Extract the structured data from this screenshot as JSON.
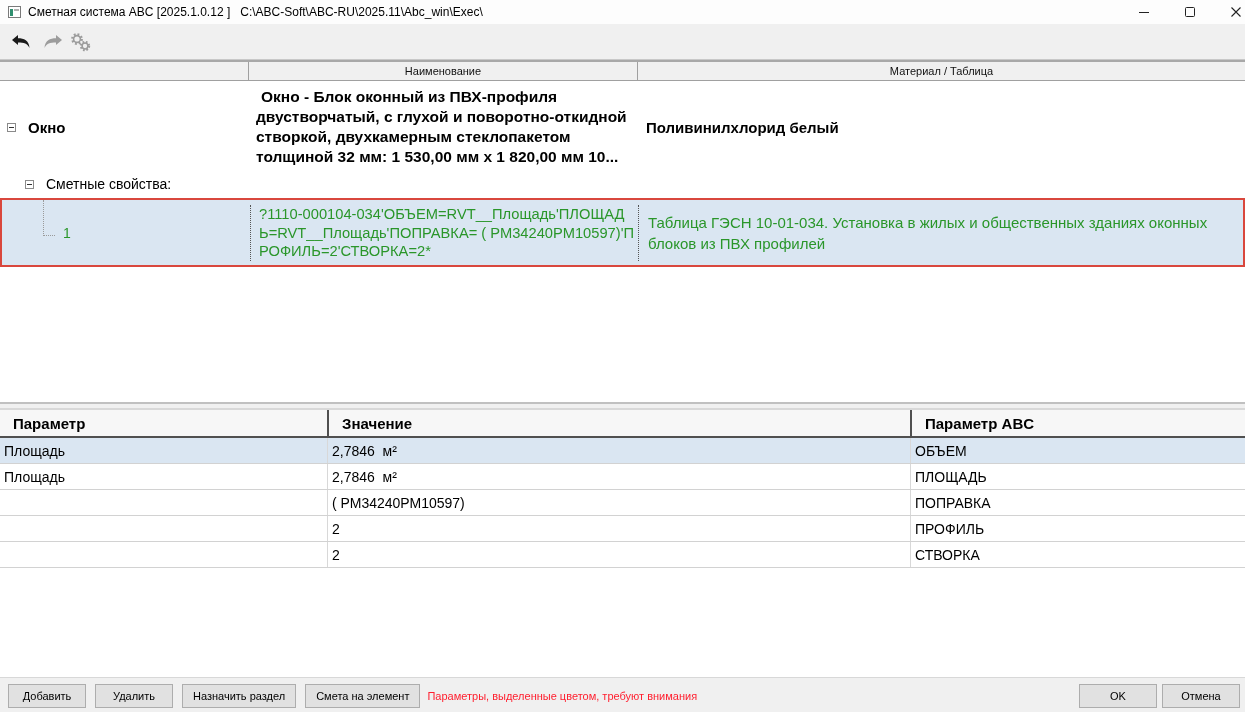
{
  "window": {
    "title": "Сметная система ABC [2025.1.0.12 ]   C:\\ABC-Soft\\ABC-RU\\2025.11\\Abc_win\\Exec\\"
  },
  "toolbar": [
    {
      "kind": "undo",
      "disabled": false
    },
    {
      "kind": "redo",
      "disabled": true
    },
    {
      "kind": "settings",
      "disabled": true
    }
  ],
  "tree": {
    "columns": [
      "Наименование",
      "Материал / Таблица"
    ],
    "rows": [
      {
        "kind": "element",
        "name": "Окно",
        "expanded": true,
        "selected": false,
        "description": "Окно - Блок оконный из ПВХ-профиля двустворчатый, с глухой и поворотно-откидной створкой, двухкамерным стеклопакетом толщиной 32 мм: 1 530,00 мм x 1 820,00 мм 10...",
        "material": "Поливинилхлорид белый",
        "children": [
          {
            "kind": "group",
            "name": "Сметные свойства:",
            "expanded": true,
            "selected": false,
            "children": [
              {
                "kind": "estimate",
                "name": "1",
                "selected": true,
                "description": "?1110-000104-034'ОБЪЕМ=RVT__Площадь'ПЛОЩАДЬ=RVT__Площадь'ПОПРАВКА= ( РМ34240РМ10597)'ПРОФИЛЬ=2'СТВОРКА=2*",
                "material": "Таблица ГЭСН 10-01-034. Установка в жилых и общественных зданиях оконных блоков из ПВХ профилей"
              }
            ]
          }
        ]
      }
    ]
  },
  "parameters": {
    "columns": [
      "Параметр",
      "Значение",
      "Параметр ABC"
    ],
    "rows": [
      {
        "parameter": "Площадь",
        "value": "2,7846  м²",
        "abc_parameter": "ОБЪЕМ",
        "selected": true
      },
      {
        "parameter": "Площадь",
        "value": "2,7846  м²",
        "abc_parameter": "ПЛОЩАДЬ",
        "selected": false
      },
      {
        "value": "( РМ34240РМ10597)",
        "abc_parameter": "ПОПРАВКА",
        "selected": false
      },
      {
        "value": "2",
        "abc_parameter": "ПРОФИЛЬ",
        "selected": false
      },
      {
        "value": "2",
        "abc_parameter": "СТВОРКА",
        "selected": false
      }
    ]
  },
  "footer": {
    "left_buttons": [
      "Добавить",
      "Удалить",
      "Назначить раздел",
      "Смета на элемент"
    ],
    "warning": "Параметры, выделенные цветом, требуют внимания",
    "right_buttons": [
      "OK",
      "Отмена"
    ]
  }
}
